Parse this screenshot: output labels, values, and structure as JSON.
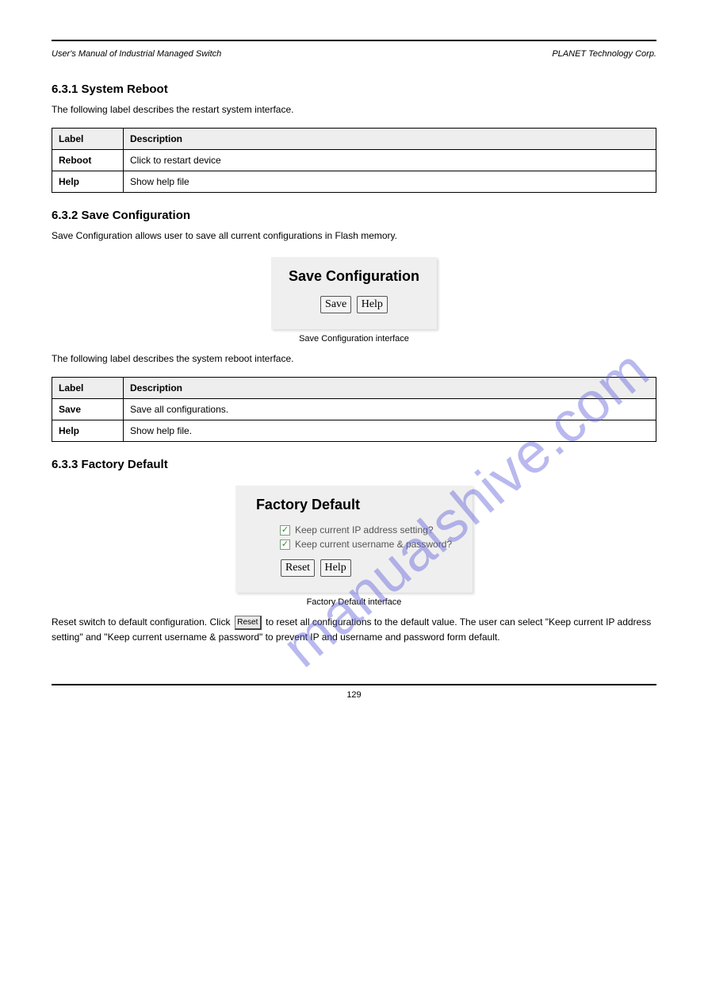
{
  "header": {
    "left": "User's Manual of Industrial Managed Switch",
    "right": "PLANET Technology Corp."
  },
  "section631": {
    "title": "6.3.1 System Reboot",
    "intro": "The following label describes the restart system interface.",
    "table": [
      {
        "label": "Label",
        "desc": "Description"
      },
      {
        "label": "Reboot",
        "desc": "Click to restart device"
      },
      {
        "label": "Help",
        "desc": "Show help file"
      }
    ]
  },
  "section632": {
    "title": "6.3.2 Save Configuration",
    "intro": "Save Configuration allows user to save all current configurations in Flash memory.",
    "panel": {
      "title": "Save Configuration",
      "save_label": "Save",
      "help_label": "Help"
    },
    "caption": "Save Configuration interface",
    "desc_intro": "The following label describes the system reboot interface.",
    "table": [
      {
        "label": "Label",
        "desc": "Description"
      },
      {
        "label": "Save",
        "desc": "Save all configurations."
      },
      {
        "label": "Help",
        "desc": "Show help file."
      }
    ]
  },
  "section633": {
    "title": "6.3.3 Factory Default",
    "panel": {
      "title": "Factory Default",
      "check1": "Keep current IP address setting?",
      "check2": "Keep current username & password?",
      "reset_label": "Reset",
      "help_label": "Help"
    },
    "caption": "Factory Default interface",
    "body_before": "Reset switch to default configuration. Click ",
    "inline_btn": "Reset",
    "body_after": " to reset all configurations to the default value. The user can select \"Keep current IP address setting\" and \"Keep current username & password\" to prevent IP and username and password form default."
  },
  "footer": {
    "page": "129"
  },
  "watermark": "manualshive.com"
}
